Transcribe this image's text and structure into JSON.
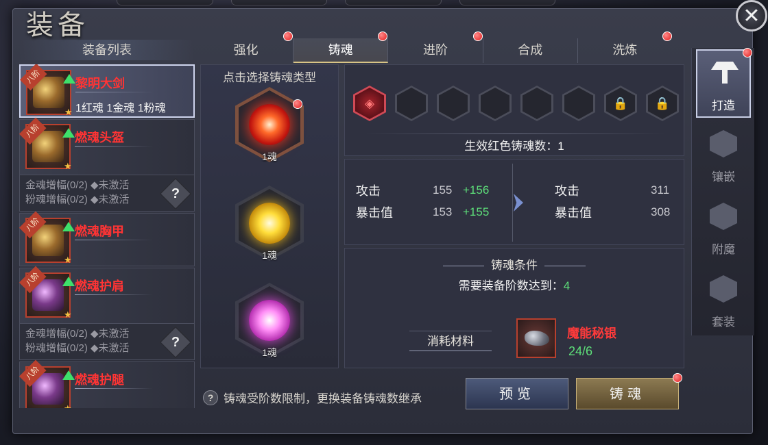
{
  "window": {
    "title": "装备"
  },
  "close": {
    "glyph": "✕"
  },
  "equipment_list": {
    "header": "装备列表",
    "items": [
      {
        "rank": "八阶",
        "name": "黎明大剑",
        "souls": "1红魂 1金魂 1粉魂",
        "selected": true,
        "color": "gold"
      },
      {
        "rank": "八阶",
        "name": "燃魂头盔",
        "souls": "",
        "color": "gold",
        "sub": [
          "金魂增幅(0/2) ◆未激活",
          "粉魂增幅(0/2) ◆未激活"
        ]
      },
      {
        "rank": "八阶",
        "name": "燃魂胸甲",
        "souls": "",
        "color": "gold"
      },
      {
        "rank": "八阶",
        "name": "燃魂护肩",
        "souls": "",
        "color": "purple",
        "sub": [
          "金魂增幅(0/2) ◆未激活",
          "粉魂增幅(0/2) ◆未激活"
        ]
      },
      {
        "rank": "八阶",
        "name": "燃魂护腿",
        "souls": "",
        "color": "purple"
      }
    ],
    "help_glyph": "?"
  },
  "tabs": [
    {
      "label": "强化",
      "dot": true
    },
    {
      "label": "铸魂",
      "dot": true,
      "active": true
    },
    {
      "label": "进阶",
      "dot": true
    },
    {
      "label": "合成",
      "dot": false
    },
    {
      "label": "洗炼",
      "dot": true
    }
  ],
  "soul_types": {
    "title": "点击选择铸魂类型",
    "orbs": [
      {
        "type": "red",
        "label": "1魂",
        "selected": true
      },
      {
        "type": "gold",
        "label": "1魂"
      },
      {
        "type": "pink",
        "label": "1魂"
      }
    ]
  },
  "slots": {
    "states": [
      "red",
      "empty",
      "empty",
      "empty",
      "empty",
      "empty",
      "locked",
      "locked"
    ],
    "lock_glyph": "🔒",
    "effective_label": "生效红色铸魂数：1"
  },
  "stats": {
    "current": [
      {
        "label": "攻击",
        "value": "155",
        "increase": "+156"
      },
      {
        "label": "暴击值",
        "value": "153",
        "increase": "+155"
      }
    ],
    "result": [
      {
        "label": "攻击",
        "value": "311"
      },
      {
        "label": "暴击值",
        "value": "308"
      }
    ]
  },
  "condition": {
    "title": "铸魂条件",
    "requirement_label": "需要装备阶数达到：",
    "requirement_value": "4",
    "material_label": "消耗材料",
    "material_name": "魔能秘银",
    "material_count": "24/6"
  },
  "footer": {
    "tip": "铸魂受阶数限制，更换装备铸魂数继承",
    "tip_glyph": "?",
    "preview_button": "预览",
    "forge_button": "铸魂"
  },
  "side_nav": [
    {
      "label": "打造",
      "active": true,
      "dot": true
    },
    {
      "label": "镶嵌"
    },
    {
      "label": "附魔"
    },
    {
      "label": "套装"
    }
  ]
}
